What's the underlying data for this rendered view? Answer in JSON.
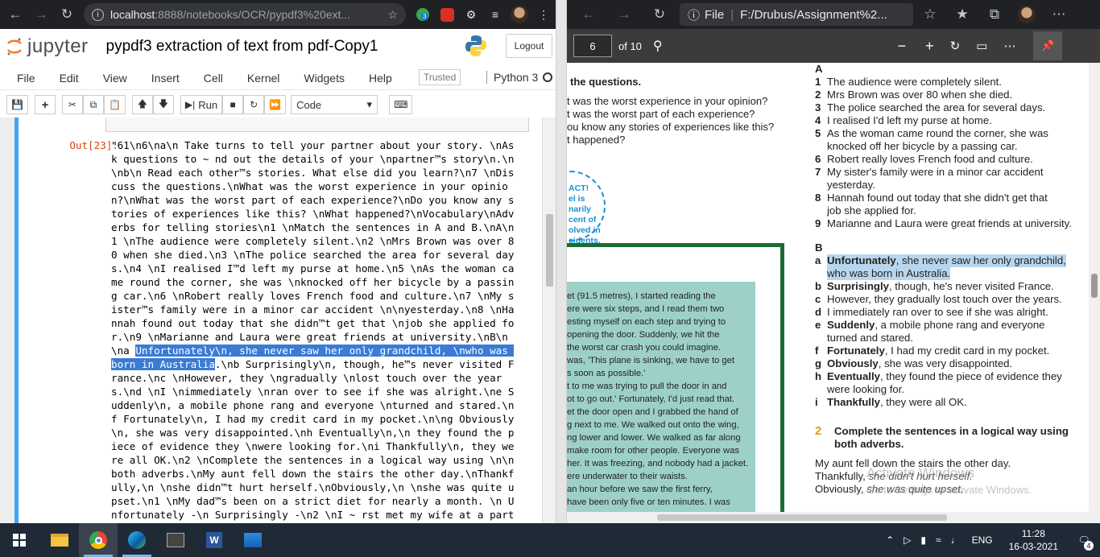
{
  "chrome": {
    "url_host": "localhost",
    "url_rest": ":8888/notebooks/OCR/pypdf3%20ext...",
    "ext_badge": "3"
  },
  "jupyter": {
    "logo": "jupyter",
    "title": "pypdf3 extraction of text from pdf-Copy1",
    "logout": "Logout",
    "menu": [
      "File",
      "Edit",
      "View",
      "Insert",
      "Cell",
      "Kernel",
      "Widgets",
      "Help"
    ],
    "trusted": "Trusted",
    "kernel": "Python 3",
    "toolbar": {
      "run": "Run",
      "cell_type": "Code"
    },
    "out_prompt": "Out[23]:",
    "out_before": "\"61\\n6\\na\\n Take turns to tell your partner about your story. \\nAs\nk questions to ~ nd out the details of your \\npartner™s story\\n.\\n\n\\nb\\n Read each other™s stories. What else did you learn?\\n7 \\nDis\ncuss the questions.\\nWhat was the worst experience in your opinio\nn?\\nWhat was the worst part of each experience?\\nDo you know any s\ntories of experiences like this? \\nWhat happened?\\nVocabulary\\nAdv\nerbs for telling stories\\n1 \\nMatch the sentences in A and B.\\nA\\n\n1 \\nThe audience were completely silent.\\n2 \\nMrs Brown was over 8\n0 when she died.\\n3 \\nThe police searched the area for several day\ns.\\n4 \\nI realised I™d left my purse at home.\\n5 \\nAs the woman ca\nme round the corner, she was \\nknocked off her bicycle by a passin\ng car.\\n6 \\nRobert really loves French food and culture.\\n7 \\nMy s\nister™s family were in a minor car accident \\n\\nyesterday.\\n8 \\nHa\nnnah found out today that she didn™t get that \\njob she applied fo\nr.\\n9 \\nMarianne and Laura were great friends at university.\\nB\\n\n\\na ",
    "out_sel1": "Unfortunately\\n, she never saw her only grandchild, \\nwho was ",
    "out_sel2": "born in Australia",
    "out_after": ".\\nb Surprisingly\\n, though, he™s never visited F\nrance.\\nc \\nHowever, they \\ngradually \\nlost touch over the year\ns.\\nd \\nI \\nimmediately \\nran over to see if she was alright.\\ne S\nuddenly\\n, a mobile phone rang and everyone \\nturned and stared.\\n\nf Fortunately\\n, I had my credit card in my pocket.\\n\\ng Obviously\n\\n, she was very disappointed.\\nh Eventually\\n,\\n they found the p\niece of evidence they \\nwere looking for.\\ni Thankfully\\n, they we\nre all OK.\\n2 \\nComplete the sentences in a logical way using \\n\\n\nboth adverbs.\\nMy aunt fell down the stairs the other day.\\nThankf\nully,\\n \\nshe didn™t hurt herself.\\nObviously,\\n \\nshe was quite u\npset.\\n1 \\nMy dad™s been on a strict diet for nearly a month. \\n U\nnfortunately -\\n Surprisingly -\\n2 \\nI ~ rst met my wife at a part"
  },
  "edge": {
    "file_label": "File",
    "path": "F:/Drubus/Assignment%2...",
    "page": "6",
    "of_pages": "of 10"
  },
  "pdf": {
    "q_title": "the questions.",
    "q_lines": [
      "t was the worst experience in your opinion?",
      "t was the worst part of each experience?",
      "ou know any stories of experiences like this?",
      "t happened?"
    ],
    "ve": "ve",
    "ce": "ce",
    "badge_lines": [
      "ACT!",
      "el is",
      "narily",
      "cent of",
      "olved in",
      "cidents.",
      "e!"
    ],
    "story": [
      "et (91.5 metres), I started reading the",
      "ere were six steps, and I read them two",
      "esting myself on each step and trying to",
      "opening the door. Suddenly, we hit the",
      "the worst car crash you could imagine.",
      "was, 'This plane is sinking, we have to get",
      "s soon as possible.'",
      "t to me was trying to pull the door in and",
      "ot to go out.' Fortunately, I'd just read that.",
      "et the door open and I grabbed the hand of",
      "g next to me. We walked out onto the wing,",
      "ng lower and lower. We walked as far along",
      "make room for other people. Everyone was",
      "her. It was freezing, and nobody had a jacket.",
      "ere underwater to their waists.",
      " an hour before we saw the first ferry,",
      "have been only five or ten minutes. I was"
    ],
    "colA": "A",
    "listA": [
      {
        "n": "1",
        "t": "The audience were completely silent."
      },
      {
        "n": "2",
        "t": "Mrs Brown was over 80 when she died."
      },
      {
        "n": "3",
        "t": "The police searched the area for several days."
      },
      {
        "n": "4",
        "t": "I realised I'd left my purse at home."
      },
      {
        "n": "5",
        "t": "As the woman came round the corner, she was"
      },
      {
        "n": "",
        "t": "knocked off her bicycle by a passing car."
      },
      {
        "n": "6",
        "t": "Robert really loves French food and culture."
      },
      {
        "n": "7",
        "t": "My sister's family were in a minor car accident"
      },
      {
        "n": "",
        "t": "yesterday."
      },
      {
        "n": "8",
        "t": "Hannah found out today that she didn't get that"
      },
      {
        "n": "",
        "t": "job she applied for."
      },
      {
        "n": "9",
        "t": "Marianne and Laura were great friends at university."
      }
    ],
    "colB": "B",
    "listB": [
      {
        "n": "a",
        "b": "Unfortunately",
        "t": ", she never saw her only grandchild,",
        "hl": true
      },
      {
        "n": "",
        "b": "",
        "t": "who was born in Australia.",
        "hl": true
      },
      {
        "n": "b",
        "b": "Surprisingly",
        "t": ", though, he's never visited France."
      },
      {
        "n": "c",
        "b": "",
        "t": "However, they gradually lost touch over the years."
      },
      {
        "n": "d",
        "b": "",
        "t": "I immediately ran over to see if she was alright."
      },
      {
        "n": "e",
        "b": "Suddenly",
        "t": ", a mobile phone rang and everyone"
      },
      {
        "n": "",
        "b": "",
        "t": "turned and stared."
      },
      {
        "n": "f",
        "b": "Fortunately",
        "t": ", I had my credit card in my pocket."
      },
      {
        "n": "g",
        "b": "Obviously",
        "t": ", she was very disappointed."
      },
      {
        "n": "h",
        "b": "Eventually",
        "t": ", they found the piece of evidence they"
      },
      {
        "n": "",
        "b": "",
        "t": "were looking for."
      },
      {
        "n": "i",
        "b": "Thankfully",
        "t": ", they were all OK."
      }
    ],
    "ex2_num": "2",
    "ex2_title1": "Complete the sentences in a logical way using",
    "ex2_title2": "both adverbs.",
    "ex2_l1": "My aunt fell down the stairs the other day.",
    "ex2_l2a": "Thankfully,",
    "ex2_l2b": " she didn't hurt herself.",
    "ex2_l3a": "Obviously,",
    "ex2_l3b": " she was quite upset.",
    "watermark1": "Activate Windows",
    "watermark2": "Go to Settings to activate Windows."
  },
  "taskbar": {
    "lang": "ENG",
    "time": "11:28",
    "date": "16-03-2021",
    "notif": "4"
  }
}
